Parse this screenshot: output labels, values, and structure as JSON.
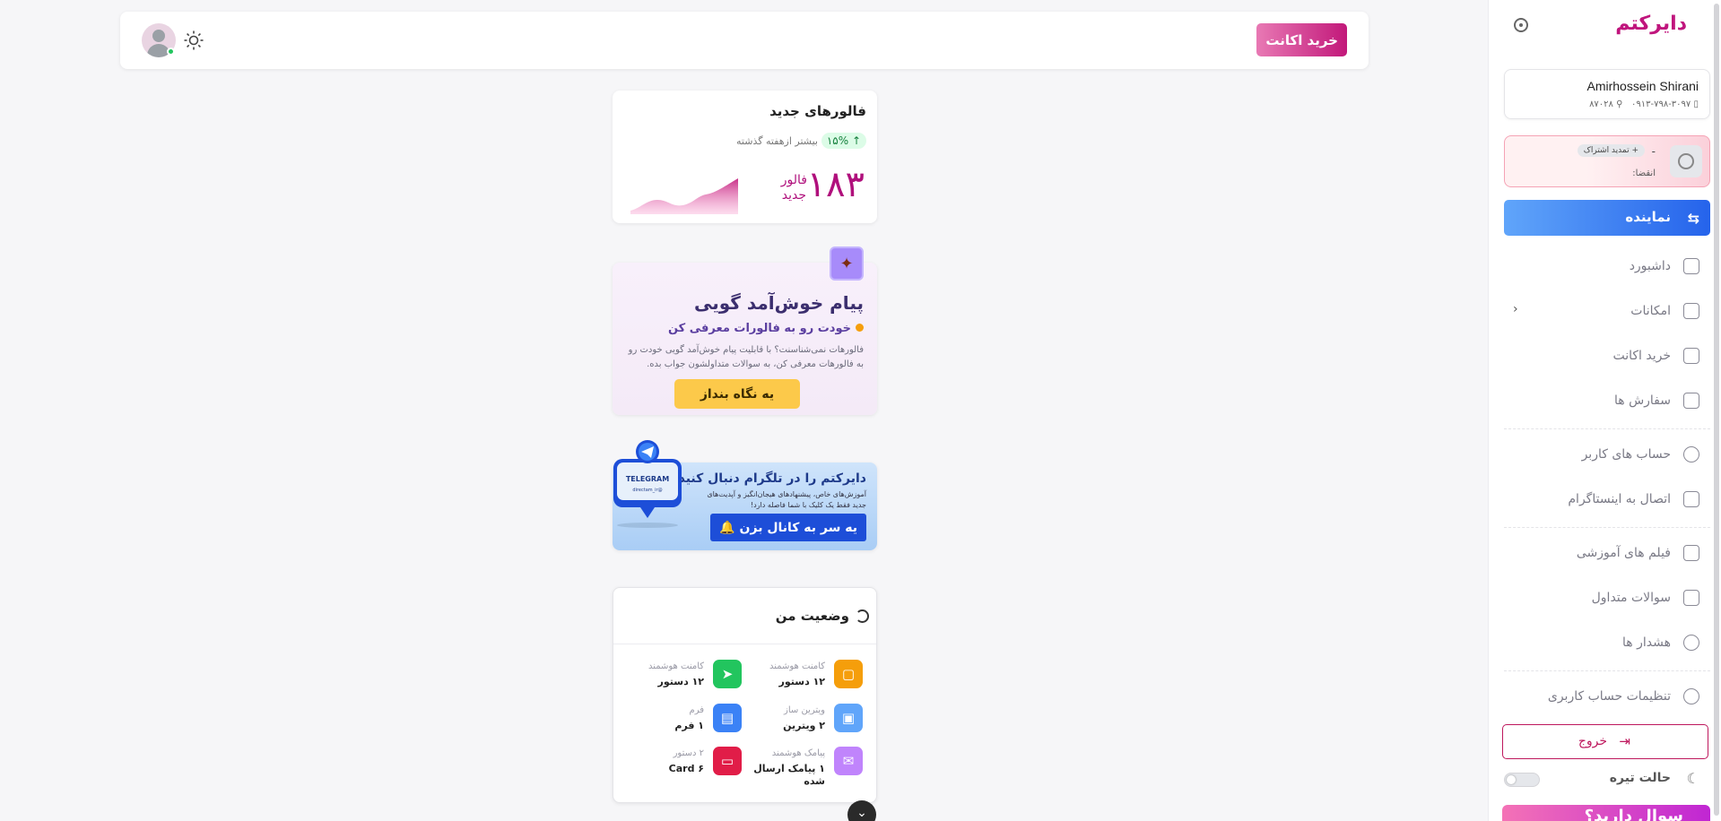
{
  "header": {
    "buy_account": "خرید اکانت"
  },
  "followers_card": {
    "title": "فالورهای جدید",
    "badge": "۱۵%",
    "compare": "بیشتر ازهفته گذشته",
    "count": "۱۸۳",
    "unit_line1": "فالور",
    "unit_line2": "جدید"
  },
  "welcome_card": {
    "title": "پیام خوش‌آمد گویی",
    "subtitle": "خودت رو به فالورات معرفی کن",
    "description": "فالورهات نمی‌شناسنت؟ با قابلیت پیام خوش‌آمد گویی خودت رو به فالورهات معرفی کن، به سوالات متداولشون جواب بده.",
    "cta": "یه نگاه بنداز"
  },
  "telegram_card": {
    "title": "دایرکتم را در تلگرام دنبال کنید.",
    "description": "آموزش‌های خاص، پیشنهادهای هیجان‌انگیز و آپدیت‌های جدید فقط یک کلیک با شما فاصله دارد!",
    "cta": "یه سر به کانال بزن 🔔",
    "bubble_label": "TELEGRAM",
    "bubble_handle": "@directam_ir"
  },
  "status_card": {
    "title": "وضعیت من",
    "stats": [
      {
        "label": "کامنت هوشمند",
        "value": "۱۲ دستور",
        "color": "#f59e0b"
      },
      {
        "label": "کامنت هوشمند",
        "value": "۱۲ دستور",
        "color": "#22c55e"
      },
      {
        "label": "ویترین ساز",
        "value": "۲ ویترین",
        "color": "#60a5fa"
      },
      {
        "label": "فرم",
        "value": "۱ فرم",
        "color": "#3b82f6"
      },
      {
        "label": "پیامک هوشمند",
        "value": "۱ پیامک ارسال شده",
        "color": "#c084fc"
      },
      {
        "label": "۲ دستور",
        "value": "Card ۶",
        "color": "#e11d48"
      }
    ]
  },
  "sidebar": {
    "brand": "دایرکتم",
    "user_name": "Amirhossein Shirani",
    "user_phone": "۰۹۱۳-۷۹۸-۳۰۹۷",
    "user_id": "۸۷۰۲۸",
    "subscription_dash": "-",
    "renew": "+ تمدید اشتراک",
    "expiry": "انقضا:",
    "agent": "نماینده",
    "items": [
      "داشبورد",
      "امکانات",
      "خرید اکانت",
      "سفارش ها",
      "حساب های کاربر",
      "اتصال به اینستاگرام",
      "فیلم های آموزشی",
      "سوالات متداول",
      "هشدار ها",
      "تنظیمات حساب کاربری"
    ],
    "logout": "خروج",
    "dark_mode": "حالت تیره",
    "ask": "سوال دارید؟"
  },
  "colors": {
    "brand": "#c0157d",
    "agent_blue": "#2563eb",
    "accent_yellow": "#fcc94a"
  }
}
